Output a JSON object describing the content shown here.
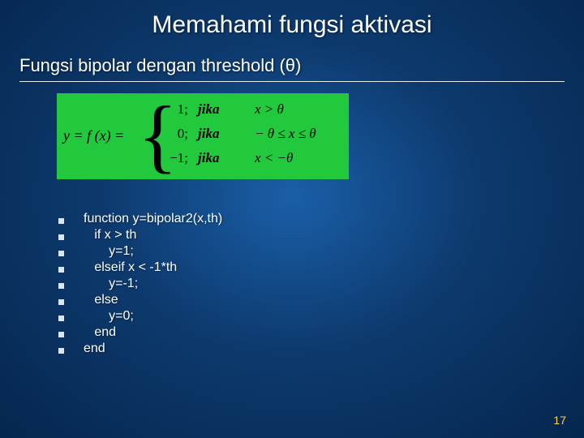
{
  "title": "Memahami fungsi aktivasi",
  "subtitle": "Fungsi bipolar dengan threshold (θ)",
  "equation": {
    "lhs": "y = f (x) =",
    "rows": [
      {
        "val": "1;",
        "jika": "jika",
        "cond": "x > θ"
      },
      {
        "val": "0;",
        "jika": "jika",
        "cond": "− θ ≤ x ≤ θ"
      },
      {
        "val": "−1;",
        "jika": "jika",
        "cond": "x < −θ"
      }
    ]
  },
  "code_lines": [
    "function y=bipolar2(x,th)",
    "   if x > th",
    "       y=1;",
    "   elseif x < -1*th",
    "       y=-1;",
    "   else",
    "       y=0;",
    "   end",
    "end"
  ],
  "page_number": "17"
}
